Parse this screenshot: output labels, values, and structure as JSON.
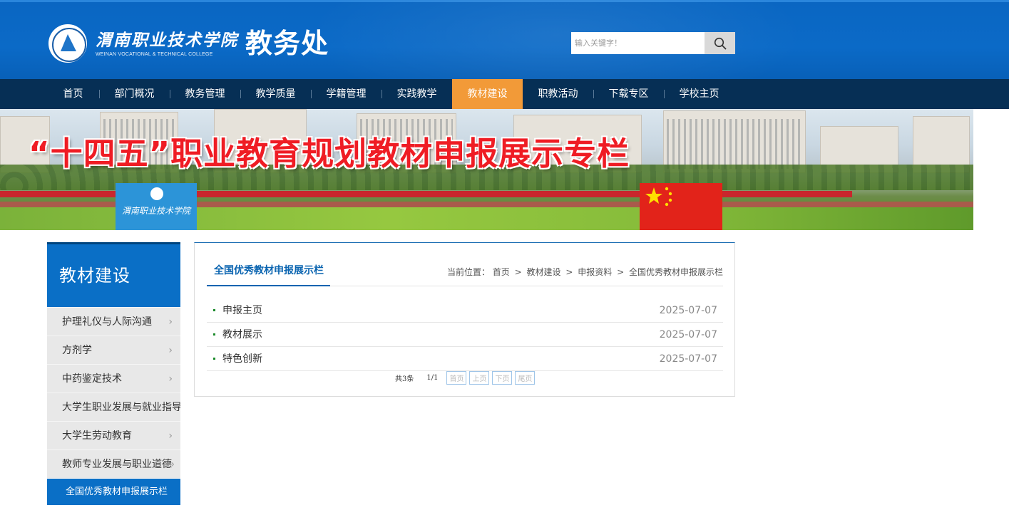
{
  "header": {
    "college_name_cn": "渭南职业技术学院",
    "college_name_en": "WEINAN VOCATIONAL & TECHNICAL COLLEGE",
    "dept_title": "教务处",
    "search_placeholder": "输入关键字！"
  },
  "nav": {
    "items": [
      {
        "label": "首页"
      },
      {
        "label": "部门概况"
      },
      {
        "label": "教务管理"
      },
      {
        "label": "教学质量"
      },
      {
        "label": "学籍管理"
      },
      {
        "label": "实践教学"
      },
      {
        "label": "教材建设"
      },
      {
        "label": "职教活动"
      },
      {
        "label": "下载专区"
      },
      {
        "label": "学校主页"
      }
    ],
    "active_index": 6
  },
  "banner": {
    "headline": "“十四五”职业教育规划教材申报展示专栏",
    "board_text": "渭南职业技术学院"
  },
  "sidebar": {
    "title": "教材建设",
    "items": [
      {
        "label": "护理礼仪与人际沟通"
      },
      {
        "label": "方剂学"
      },
      {
        "label": "中药鉴定技术"
      },
      {
        "label": "大学生职业发展与就业指导"
      },
      {
        "label": "大学生劳动教育"
      },
      {
        "label": "教师专业发展与职业道德"
      },
      {
        "label": "全国优秀教材申报展示栏"
      }
    ]
  },
  "main": {
    "title": "全国优秀教材申报展示栏",
    "breadcrumb": {
      "prefix": "当前位置：",
      "items": [
        "首页",
        "教材建设",
        "申报资料",
        "全国优秀教材申报展示栏"
      ],
      "separator": ">"
    },
    "list": [
      {
        "title": "申报主页",
        "date": "2025-07-07"
      },
      {
        "title": "教材展示",
        "date": "2025-07-07"
      },
      {
        "title": "特色创新",
        "date": "2025-07-07"
      }
    ],
    "pager": {
      "total": "共3条",
      "page": "1/1",
      "first": "首页",
      "prev": "上页",
      "next": "下页",
      "last": "尾页"
    }
  },
  "colors": {
    "header_blue": "#0b6ac7",
    "nav_dark": "#062f55",
    "nav_active": "#f29a38",
    "sidebar_blue": "#0a6fc6",
    "title_blue": "#0a64b0"
  }
}
